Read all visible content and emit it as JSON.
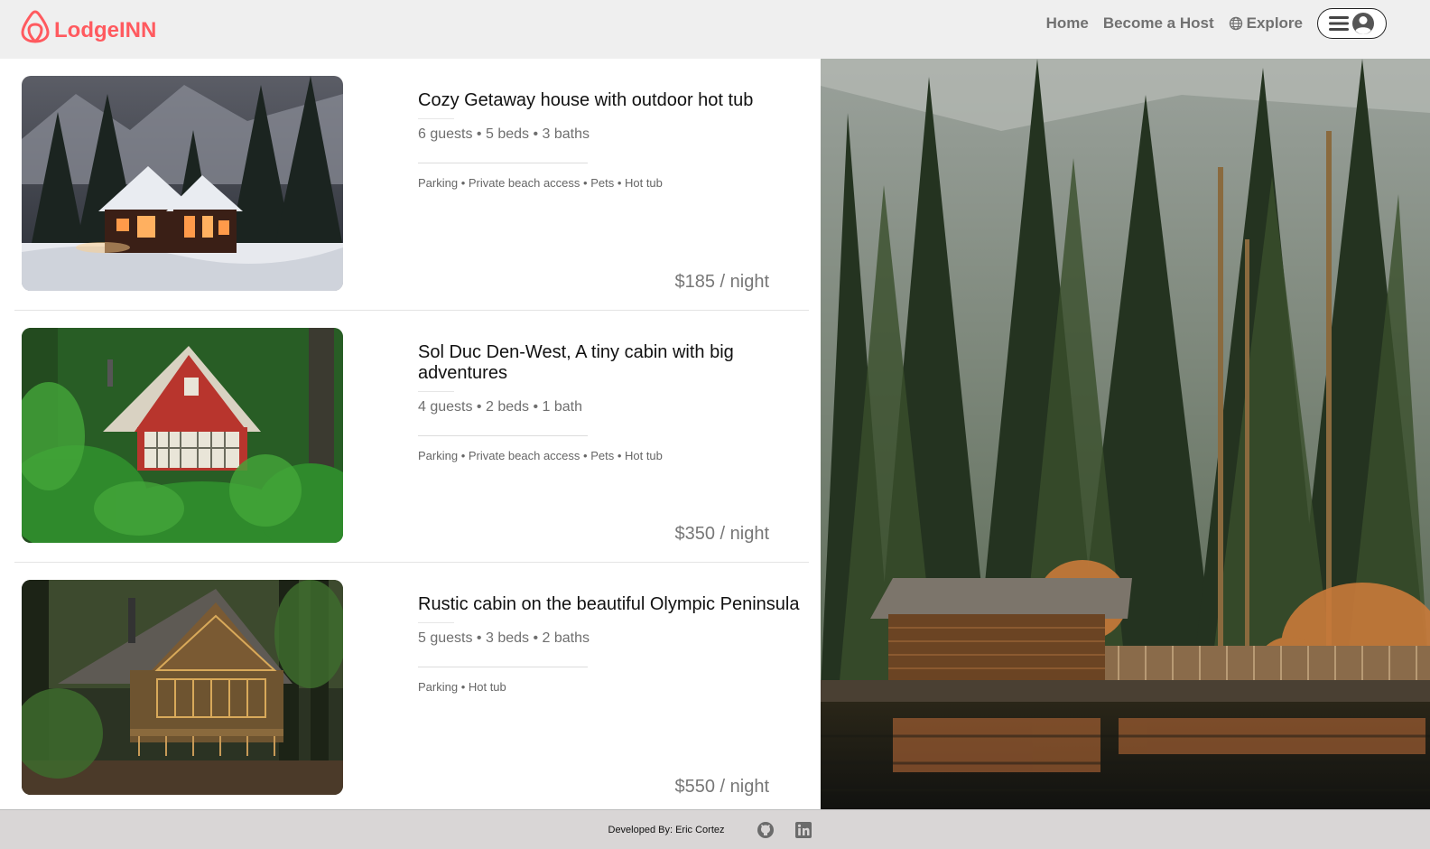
{
  "brand": {
    "name": "LodgeINN",
    "logo": "airbnb-belo-icon",
    "color": "#ff5a5f"
  },
  "nav": {
    "home": "Home",
    "become_host": "Become a Host",
    "explore": "Explore",
    "explore_icon": "globe-icon",
    "menu_icon": "hamburger-user-icon"
  },
  "listings": [
    {
      "title": "Cozy Getaway house with outdoor hot tub",
      "details": "6 guests • 5 beds • 3 baths",
      "amenities": "Parking • Private beach access • Pets • Hot tub",
      "price": "$185 / night"
    },
    {
      "title": "Sol Duc Den-West, A tiny cabin with big adventures",
      "details": "4 guests • 2 beds • 1 bath",
      "amenities": "Parking • Private beach access • Pets • Hot tub",
      "price": "$350 / night"
    },
    {
      "title": "Rustic cabin on the beautiful Olympic Peninsula",
      "details": "5 guests • 3 beds • 2 baths",
      "amenities": "Parking • Hot tub",
      "price": "$550 / night"
    }
  ],
  "footer": {
    "credit": "Developed By: Eric Cortez",
    "icons": [
      "github-icon",
      "linkedin-icon"
    ]
  }
}
